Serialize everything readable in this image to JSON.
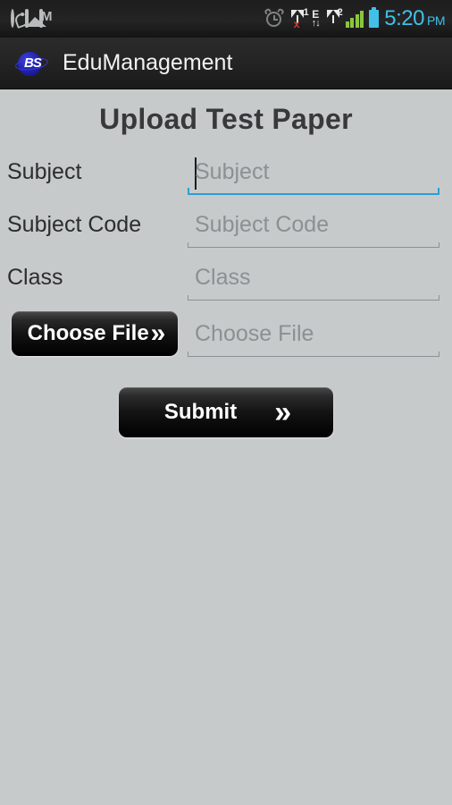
{
  "status_bar": {
    "left_icons": [
      {
        "name": "whatsapp-icon",
        "label": "WhatsApp notification"
      },
      {
        "name": "gallery-icon",
        "label": "Gallery notification"
      },
      {
        "name": "gmail-icon",
        "label": "Gmail notification"
      }
    ],
    "alarm_icon": "alarm-clock-icon",
    "sim1": {
      "label": "1",
      "x_mark": "x"
    },
    "network_type": "E",
    "data_arrows": "↑↓",
    "sim2": {
      "label": "2"
    },
    "signal_bars": 4,
    "battery_icon": "battery-icon",
    "time": "5:20",
    "time_period": "PM",
    "accent_time_color": "#41c0e8",
    "signal_color": "#8cc63e"
  },
  "app_bar": {
    "logo_text": "BS",
    "logo_name": "edumanagement-logo",
    "title": "EduManagement"
  },
  "page": {
    "title": "Upload Test Paper",
    "background_color": "#c6cacb"
  },
  "form": {
    "fields": [
      {
        "label": "Subject",
        "placeholder": "Subject",
        "value": "",
        "focused": true,
        "underline_color": "#2f9ed4"
      },
      {
        "label": "Subject Code",
        "placeholder": "Subject Code",
        "value": "",
        "focused": false,
        "underline_color": "#8d9193"
      },
      {
        "label": "Class",
        "placeholder": "Class",
        "value": "",
        "focused": false,
        "underline_color": "#8d9193"
      }
    ],
    "choose_file": {
      "button_label": "Choose File",
      "placeholder": "Choose File",
      "value": "",
      "chevron": "»"
    },
    "submit": {
      "label": "Submit",
      "chevron": "»"
    }
  }
}
